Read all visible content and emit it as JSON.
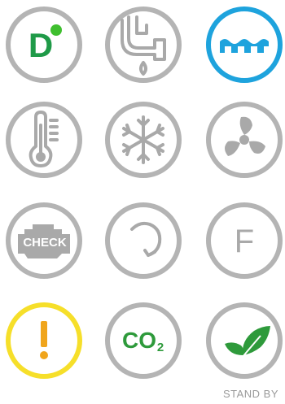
{
  "icons": [
    {
      "name": "diesel-mode-icon",
      "label": "D",
      "color": "#1f9a48",
      "dot_color": "#3fbf2f"
    },
    {
      "name": "plumbing-icon"
    },
    {
      "name": "water-level-icon",
      "color": "#1ea3dd"
    },
    {
      "name": "thermometer-icon"
    },
    {
      "name": "snowflake-icon"
    },
    {
      "name": "fan-icon"
    },
    {
      "name": "check-engine-icon",
      "label": "CHECK"
    },
    {
      "name": "refresh-icon"
    },
    {
      "name": "f-mode-icon",
      "label": "F"
    },
    {
      "name": "warning-icon",
      "color": "#f6df2a",
      "glyph_color": "#f0a51c"
    },
    {
      "name": "co2-icon",
      "label_main": "CO",
      "label_sub": "2",
      "color": "#2e9a3b"
    },
    {
      "name": "eco-leaf-icon",
      "color": "#2e9a3b"
    }
  ],
  "status": {
    "label": "STAND BY"
  },
  "colors": {
    "ring_grey": "#b4b4b4",
    "glyph_grey": "#a9a9a9",
    "accent_blue": "#1ea3dd",
    "accent_green": "#2e9a3b",
    "accent_yellow": "#f6df2a"
  }
}
